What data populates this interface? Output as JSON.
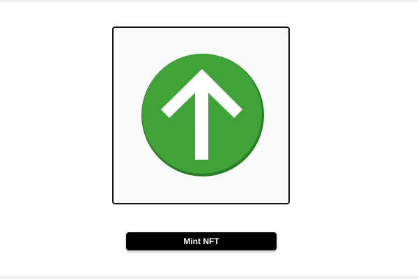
{
  "nft_preview": {
    "icon": "up-arrow-circle-icon",
    "circle_color": "#3fa33a",
    "circle_edge_color": "#2a7d27",
    "arrow_color": "#ffffff",
    "background_color": "#fafafa"
  },
  "mint_button": {
    "label": "Mint NFT",
    "background_color": "#000000",
    "text_color": "#ffffff"
  }
}
